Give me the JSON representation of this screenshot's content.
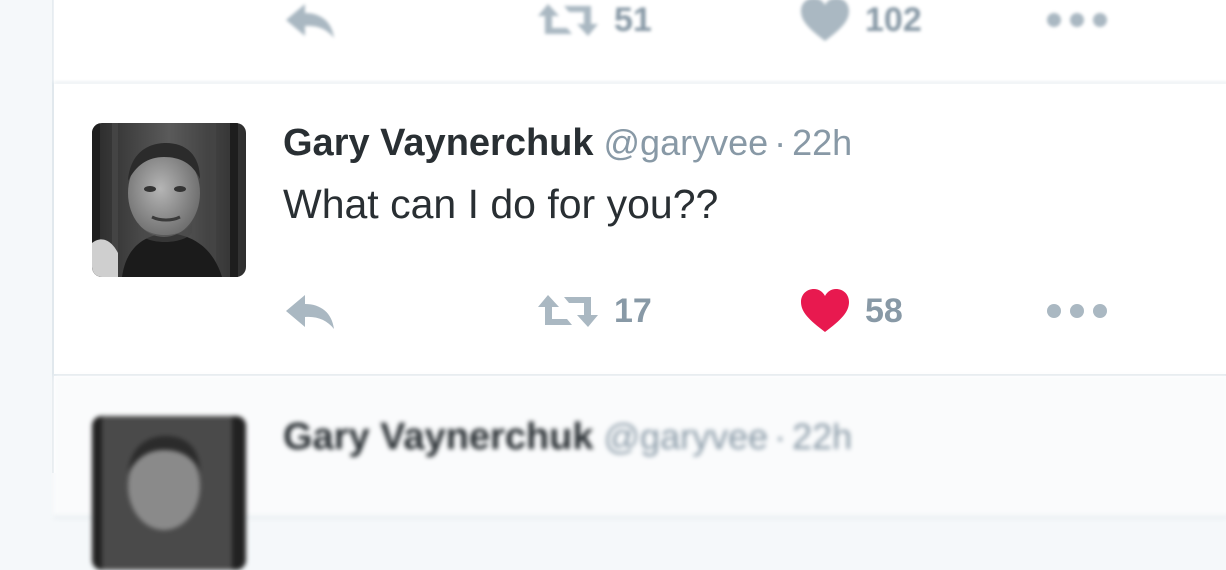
{
  "top_tweet": {
    "retweet_count": "51",
    "like_count": "102"
  },
  "main_tweet": {
    "name": "Gary Vaynerchuk",
    "handle": "@garyvee",
    "separator": "·",
    "time": "22h",
    "text": "What can I do for you??",
    "retweet_count": "17",
    "like_count": "58",
    "like_color": "#e8194f"
  },
  "bottom_tweet": {
    "name": "Gary Vaynerchuk",
    "handle": "@garyvee",
    "separator": "·",
    "time": "22h"
  },
  "icons": {
    "reply": "reply-icon",
    "retweet": "retweet-icon",
    "like": "heart-icon",
    "more": "more-dots-icon"
  },
  "colors": {
    "icon_gray": "#aab8c2",
    "text_dark": "#292f33",
    "text_muted": "#8899a6",
    "heart_red": "#e8194f"
  }
}
